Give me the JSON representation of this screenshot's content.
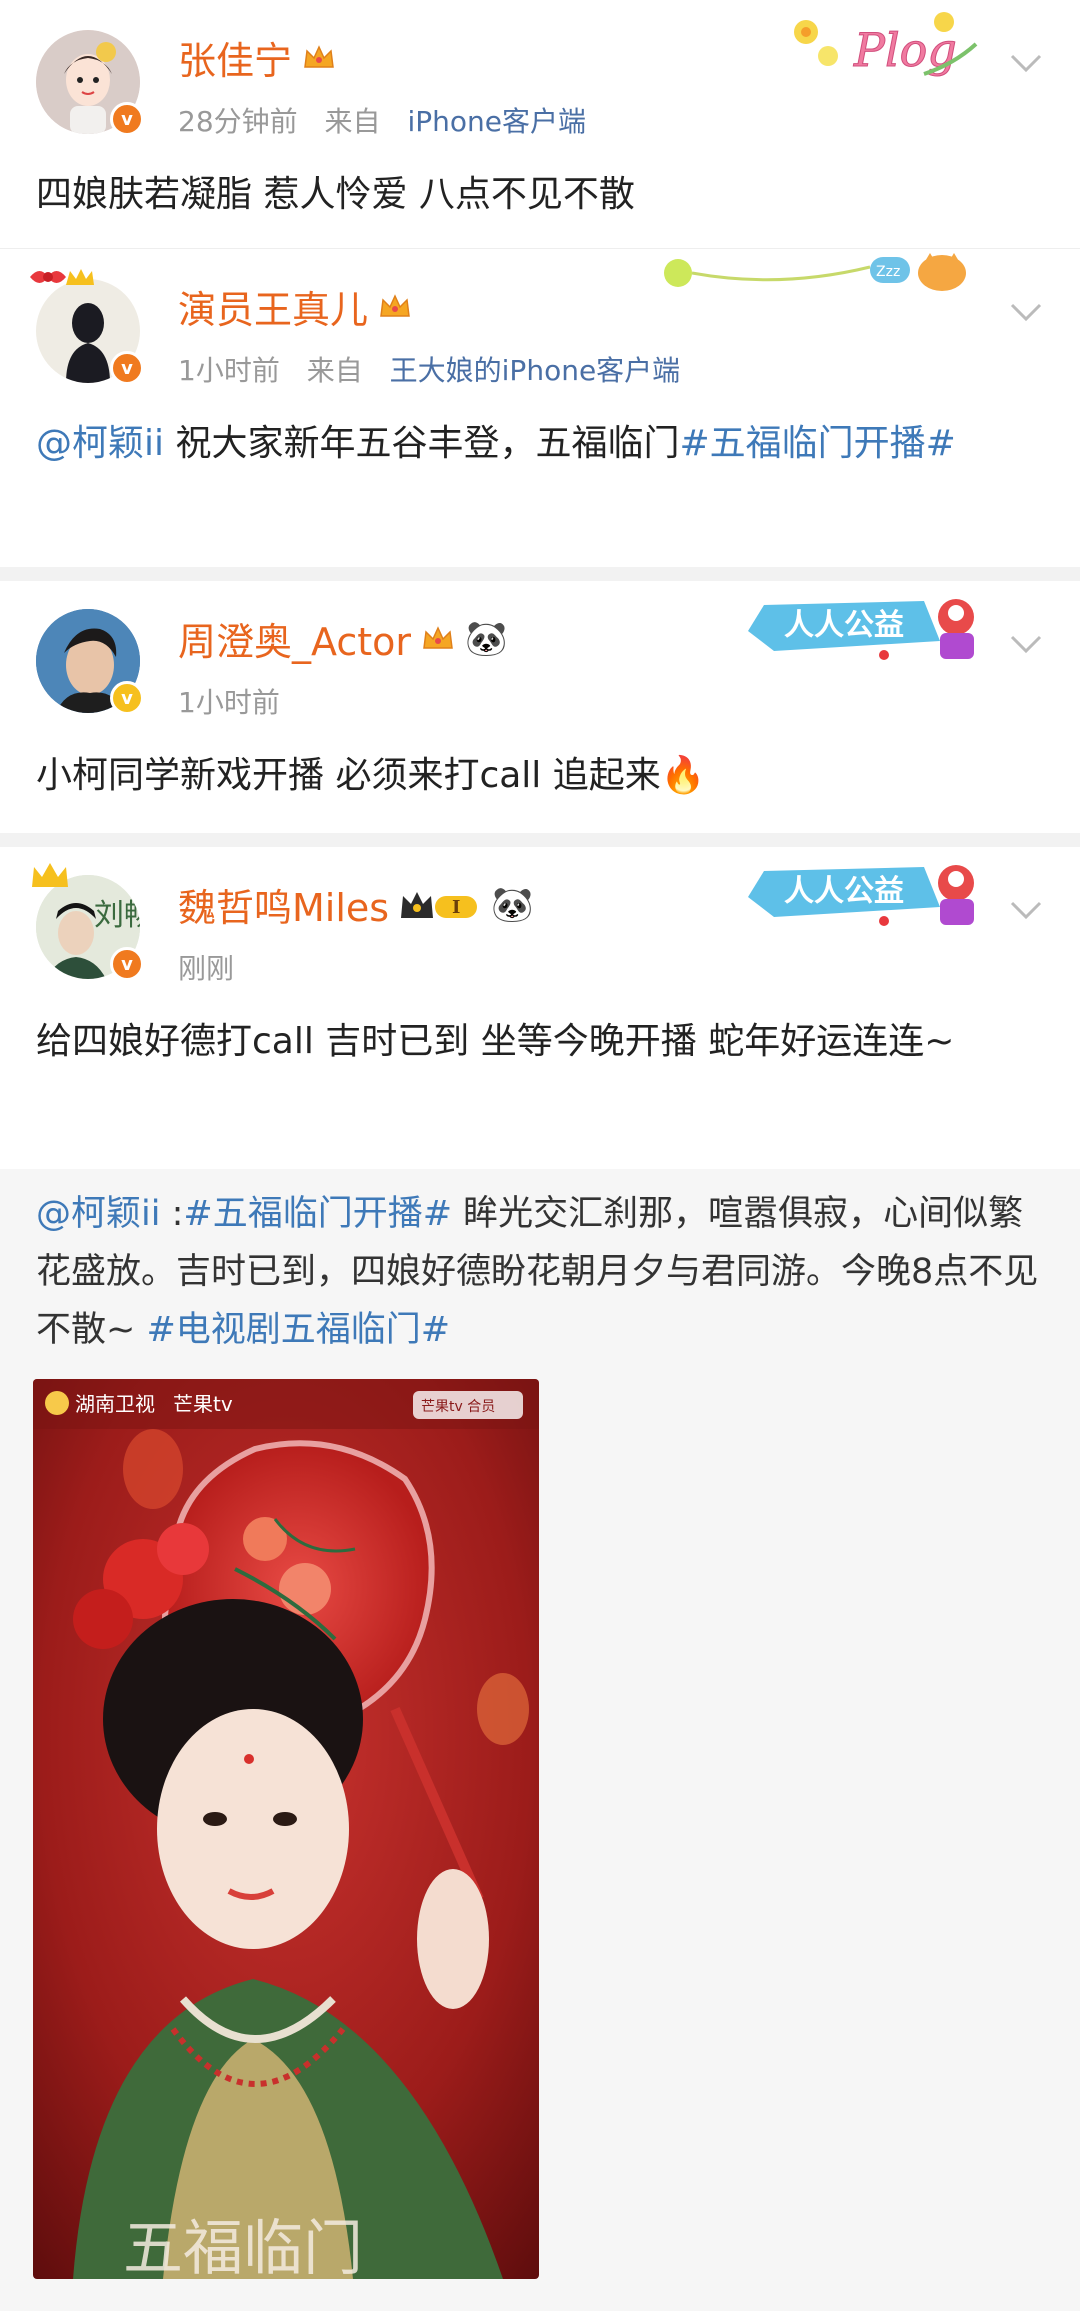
{
  "posts": [
    {
      "username": "张佳宁",
      "time": "28分钟前",
      "from_label": "来自",
      "source": "iPhone客户端",
      "content": "四娘肤若凝脂 惹人怜爱 八点不见不散",
      "deco_text": "Plog"
    },
    {
      "username": "演员王真儿",
      "time": "1小时前",
      "from_label": "来自",
      "source": "王大娘的iPhone客户端",
      "mention": "@柯颖ii",
      "content": " 祝大家新年五谷丰登，五福临门",
      "tag": "#五福临门开播#",
      "deco_text": "Zzz"
    },
    {
      "username": "周澄奥_Actor",
      "time": "1小时前",
      "content": "小柯同学新戏开播 必须来打call 追起来🔥",
      "deco_text": "人人公益"
    },
    {
      "username": "魏哲鸣Miles",
      "time": "刚刚",
      "vip_level": "I",
      "content": "给四娘好德打call 吉时已到 坐等今晚开播 蛇年好运连连~",
      "deco_text": "人人公益",
      "avatar_text": "刘畅"
    }
  ],
  "repost": {
    "mention": "@柯颖ii",
    "colon": " :",
    "tag1": "#五福临门开播#",
    "text1": " 眸光交汇刹那，喧嚣俱寂，心间似繁花盛放。吉时已到，四娘好德盼花朝月夕与君同游。今晚8点不见不散~ ",
    "tag2": "#电视剧五福临门#",
    "image": {
      "channel1": "湖南卫视",
      "channel2": "芒果tv",
      "corner": "芒果tv 合员",
      "title": "五福临门"
    }
  },
  "colors": {
    "username": "#e8651e",
    "link": "#3e79b8",
    "meta": "#999999"
  }
}
